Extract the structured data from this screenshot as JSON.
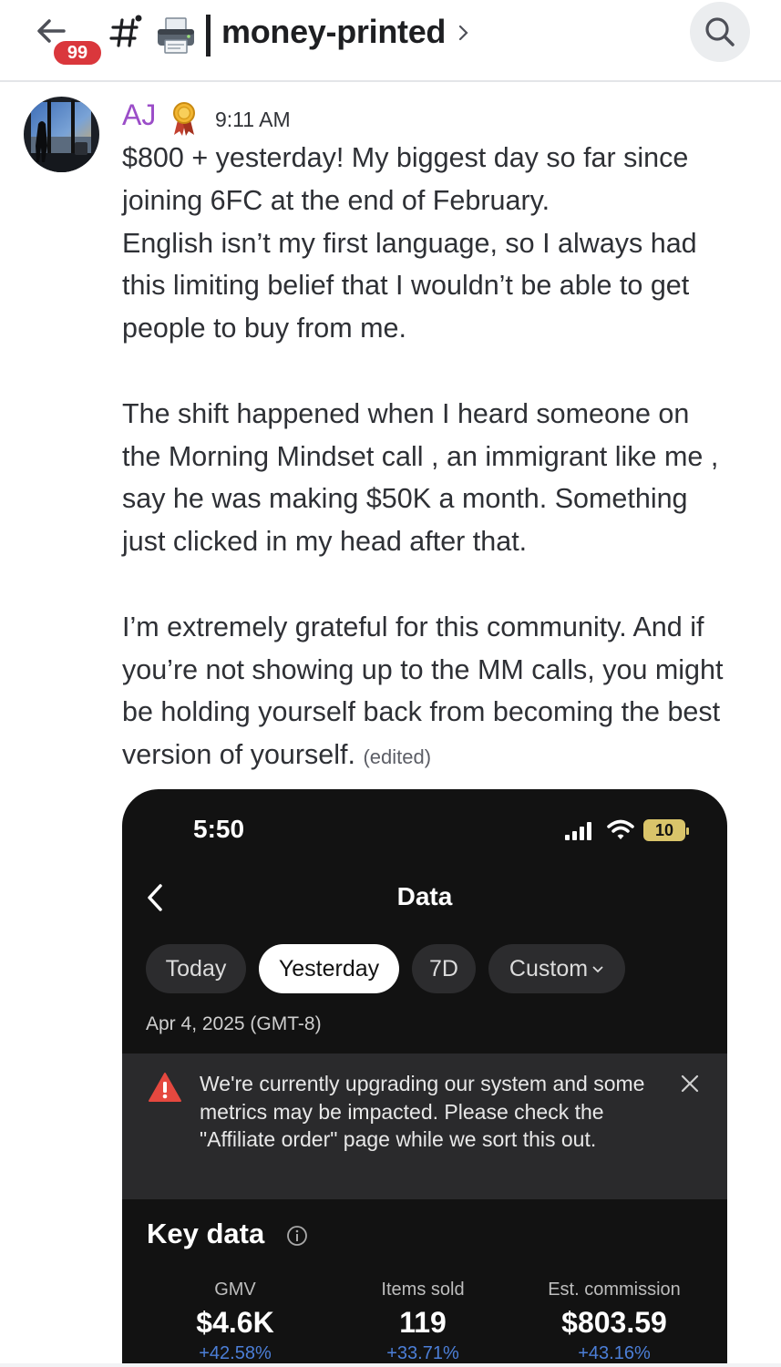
{
  "header": {
    "unread_badge": "99",
    "channel_name": "money-printed",
    "hash_symbol": "#"
  },
  "message": {
    "author": "AJ",
    "author_color": "#9b4dc8",
    "timestamp": "9:11 AM",
    "lines": [
      "$800 + yesterday!  My biggest day so far since",
      "joining 6FC at the end of February.",
      "English isn’t my first language, so I always had",
      "this limiting belief that I wouldn’t be able to get",
      "people to buy from me.",
      "",
      "The shift happened when I heard someone on",
      "the Morning Mindset call , an immigrant like me ,",
      "say he was making $50K a month. Something",
      "just clicked in my head after that.",
      "",
      "I’m extremely grateful for this community. And if",
      "you’re not showing up to the MM calls, you might",
      "be holding yourself back from becoming the best"
    ],
    "last_line": "version of yourself.",
    "edited_label": "(edited)"
  },
  "screenshot": {
    "status_time": "5:50",
    "battery": "10",
    "title": "Data",
    "tabs": [
      "Today",
      "Yesterday",
      "7D",
      "Custom"
    ],
    "active_tab": "Yesterday",
    "date": "Apr 4, 2025 (GMT-8)",
    "notice": "We're currently upgrading our system and some metrics may be impacted. Please check the \"Affiliate order\" page while we sort this out.",
    "section_title": "Key data",
    "metrics": [
      {
        "label": "GMV",
        "value": "$4.6K",
        "change": "+42.58%"
      },
      {
        "label": "Items sold",
        "value": "119",
        "change": "+33.71%"
      },
      {
        "label": "Est. commission",
        "value": "$803.59",
        "change": "+43.16%"
      }
    ],
    "accent_color": "#4c7fd8",
    "warning_color": "#e5483f"
  }
}
